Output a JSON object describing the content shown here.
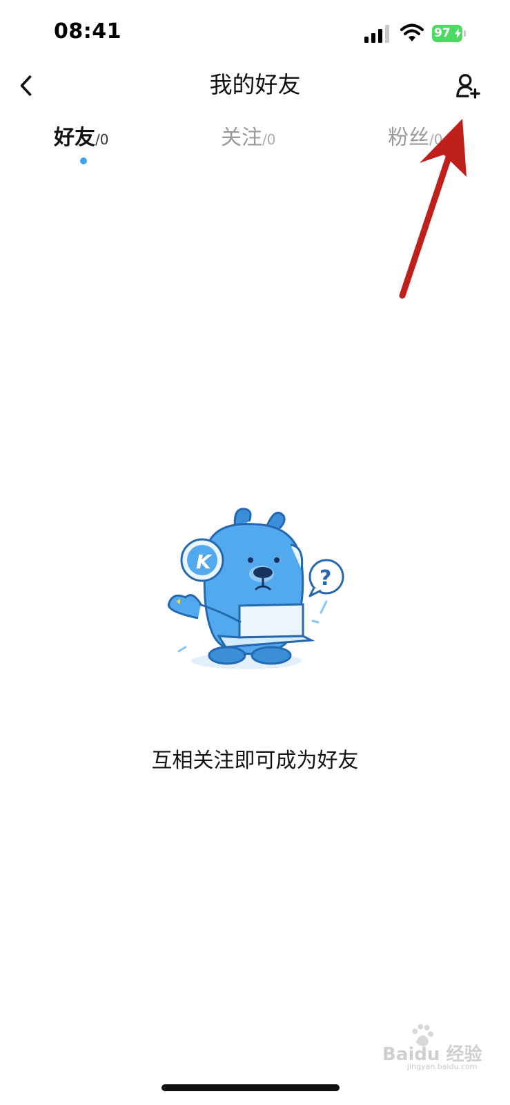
{
  "status_bar": {
    "time": "08:41",
    "battery": "97"
  },
  "nav": {
    "title": "我的好友",
    "back_icon": "chevron-left-icon",
    "add_friend_icon": "add-user-icon"
  },
  "tabs": [
    {
      "label": "好友",
      "count": "/0",
      "active": true
    },
    {
      "label": "关注",
      "count": "/0",
      "active": false
    },
    {
      "label": "粉丝",
      "count": "/0",
      "active": false
    }
  ],
  "empty_state": {
    "message": "互相关注即可成为好友",
    "illustration_letter": "K"
  },
  "watermark": {
    "brand": "Baidu 经验",
    "url": "jingyan.baidu.com"
  },
  "colors": {
    "accent": "#3fa2ef",
    "annotation_arrow": "#c0201c",
    "battery": "#4cd964"
  }
}
